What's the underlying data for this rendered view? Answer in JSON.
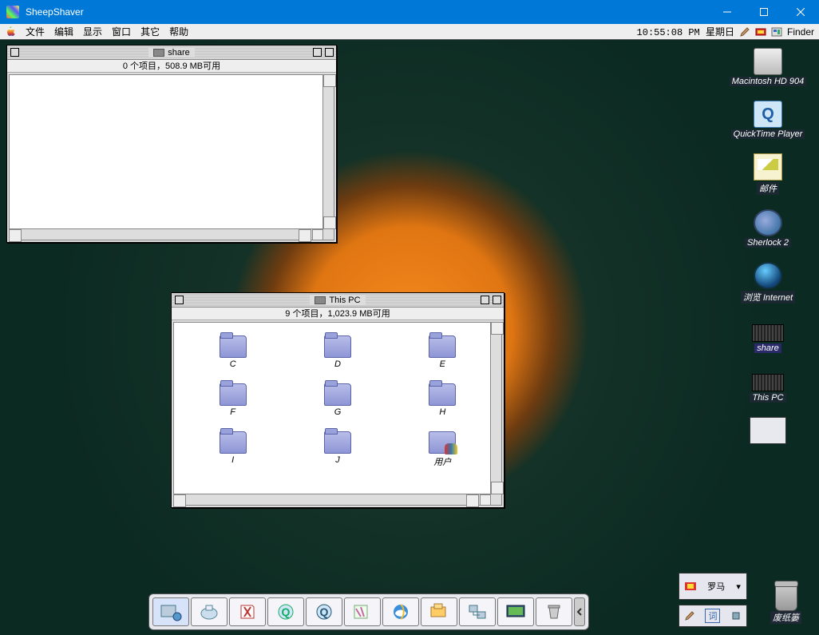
{
  "host": {
    "title": "SheepShaver"
  },
  "menubar": {
    "items": [
      "文件",
      "编辑",
      "显示",
      "窗口",
      "其它",
      "帮助"
    ],
    "time": "10:55:08 PM",
    "day": "星期日",
    "app": "Finder"
  },
  "windows": {
    "share": {
      "title": "share",
      "info": "0 个项目，508.9 MB可用"
    },
    "thispc": {
      "title": "This PC",
      "info": "9 个项目，1,023.9 MB可用",
      "items": [
        {
          "label": "C",
          "kind": "folder"
        },
        {
          "label": "D",
          "kind": "folder"
        },
        {
          "label": "E",
          "kind": "folder"
        },
        {
          "label": "F",
          "kind": "folder"
        },
        {
          "label": "G",
          "kind": "folder"
        },
        {
          "label": "H",
          "kind": "folder"
        },
        {
          "label": "I",
          "kind": "folder"
        },
        {
          "label": "J",
          "kind": "folder"
        },
        {
          "label": "用户",
          "kind": "users"
        }
      ]
    }
  },
  "desktop": {
    "icons": [
      {
        "label": "Macintosh HD 904",
        "kind": "disk"
      },
      {
        "label": "QuickTime Player",
        "kind": "qt"
      },
      {
        "label": "邮件",
        "kind": "mail"
      },
      {
        "label": "Sherlock 2",
        "kind": "sherlock"
      },
      {
        "label": "浏览 Internet",
        "kind": "browse"
      },
      {
        "label": "share",
        "kind": "pcfolder",
        "selected": true
      },
      {
        "label": "This PC",
        "kind": "pcfolder"
      }
    ],
    "trash_label": "废纸篓"
  },
  "dock": {
    "items": [
      {
        "name": "appleshare",
        "active": true
      },
      {
        "name": "printer"
      },
      {
        "name": "pdf"
      },
      {
        "name": "quicktime"
      },
      {
        "name": "video"
      },
      {
        "name": "stickies"
      },
      {
        "name": "internet-explorer"
      },
      {
        "name": "files"
      },
      {
        "name": "network"
      },
      {
        "name": "monitor"
      },
      {
        "name": "trash"
      }
    ]
  },
  "ime": {
    "script": "罗马",
    "mode": "词"
  }
}
